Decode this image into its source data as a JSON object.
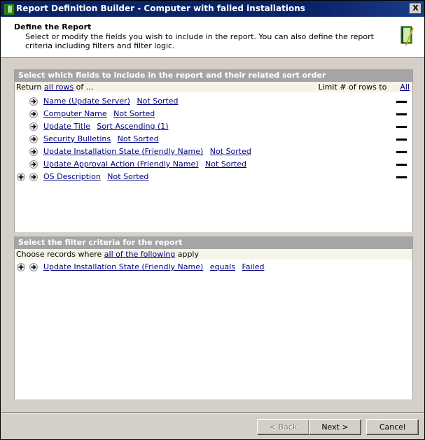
{
  "window": {
    "title": "Report Definition Builder - Computer with failed installations",
    "close_glyph": "X"
  },
  "header": {
    "title": "Define the Report",
    "description": "Select or modify the fields you wish to include in the report. You can also define the report criteria including filters and filter logic."
  },
  "fields_panel": {
    "heading": "Select which fields to include in the report and their related sort order",
    "return_prefix": "Return",
    "return_link": "all rows",
    "return_suffix": "of ...",
    "limit_label": "Limit # of rows to",
    "limit_link": "All",
    "rows": [
      {
        "field": "Name (Update Server)",
        "sort": "Not Sorted",
        "plus": false
      },
      {
        "field": "Computer Name",
        "sort": "Not Sorted",
        "plus": false
      },
      {
        "field": "Update Title",
        "sort": "Sort Ascending (1)",
        "plus": false
      },
      {
        "field": "Security Bulletins",
        "sort": "Not Sorted",
        "plus": false
      },
      {
        "field": "Update Installation State (Friendly Name)",
        "sort": "Not Sorted",
        "plus": false
      },
      {
        "field": "Update Approval Action (Friendly Name)",
        "sort": "Not Sorted",
        "plus": false
      },
      {
        "field": "OS Description",
        "sort": "Not Sorted",
        "plus": true
      }
    ]
  },
  "filter_panel": {
    "heading": "Select the filter criteria for the report",
    "choose_prefix": "Choose records where",
    "choose_link": "all of the following",
    "choose_suffix": "apply",
    "rows": [
      {
        "field": "Update Installation State (Friendly Name)",
        "operator": "equals",
        "value": "Failed"
      }
    ]
  },
  "buttons": {
    "back": "< Back",
    "next": "Next >",
    "cancel": "Cancel"
  }
}
